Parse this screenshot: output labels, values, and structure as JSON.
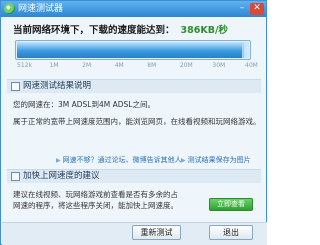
{
  "window": {
    "title": "网速测试器",
    "minimize_glyph": "–",
    "close_glyph": "✕"
  },
  "speed": {
    "label": "当前网络环境下，下载的速度能达到：",
    "value": "386KB/秒",
    "meter_fill_fraction": 0.97
  },
  "scale_ticks": [
    "512k",
    "1M",
    "2M",
    "4M",
    "8M",
    "20M",
    "30M",
    "40M"
  ],
  "result_section": {
    "header": "网速测试结果说明",
    "line1": "您的网速在：3M ADSL到4M ADSL之间。",
    "line2": "属于正常的宽带上网速度范围内，能浏览网页，在线看视频和玩网络游戏。"
  },
  "links": {
    "slow": "网速不够？通过论坛、微博告诉其他人",
    "save": "测试结果保存为图片"
  },
  "suggest_section": {
    "header": "加快上网速度的建议",
    "line1": "建议在线视频、玩网络游戏前查看是否有多余的占",
    "line2": "网速的程序，将这些程序关闭，能加快上网速度。",
    "button": "立即查看"
  },
  "footer": {
    "retest": "重新测试",
    "exit": "退出"
  },
  "colors": {
    "accent": "#3c9be0",
    "speed_value": "#2d8e2d",
    "link": "#2a6fb8"
  }
}
